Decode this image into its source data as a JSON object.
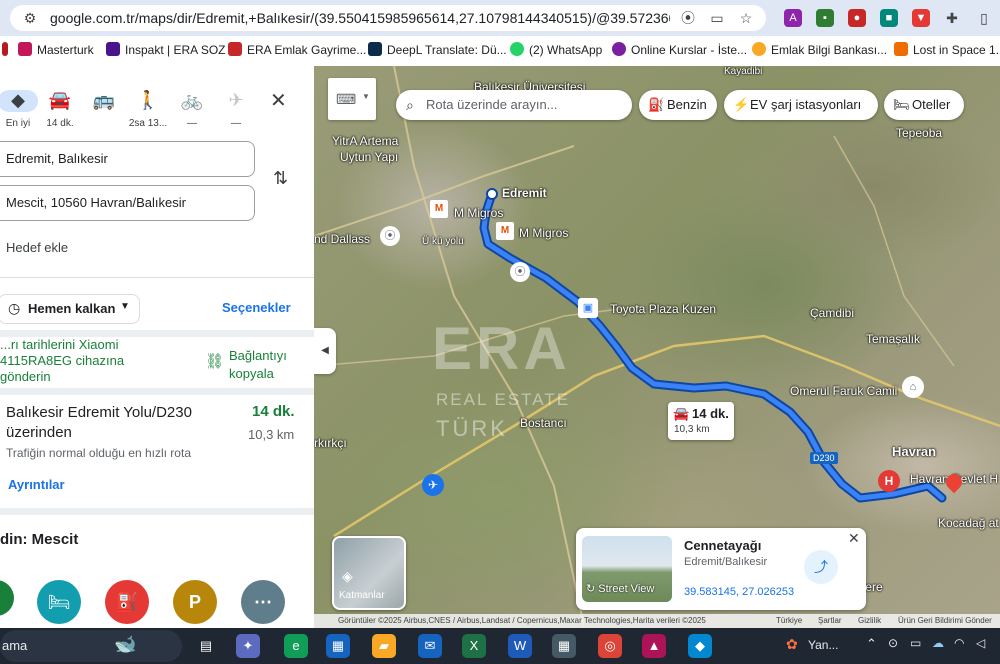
{
  "browser": {
    "url": "google.com.tr/maps/dir/Edremit,+Balıkesir/(39.550415985965614,27.10798144340515)/@39.5723608,27.02...",
    "bookmarks": [
      "Masterturk",
      "Inspakt | ERA SOZ",
      "ERA Emlak Gayrime...",
      "DeepL Translate: Dü...",
      "(2) WhatsApp",
      "Online Kurslar - İste...",
      "Emlak Bilgi Bankası...",
      "Lost in Space 1. Se"
    ]
  },
  "travel_modes": [
    {
      "name": "best",
      "label": "En iyi",
      "icon": "directions-icon"
    },
    {
      "name": "car",
      "label": "14 dk.",
      "icon": "car-icon"
    },
    {
      "name": "transit",
      "label": "",
      "icon": "bus-icon"
    },
    {
      "name": "walk",
      "label": "2sa 13...",
      "icon": "walk-icon"
    },
    {
      "name": "bike",
      "label": "—",
      "icon": "bike-icon"
    },
    {
      "name": "flight",
      "label": "—",
      "icon": "plane-icon"
    }
  ],
  "directions": {
    "origin": "Edremit, Balıkesir",
    "destination": "Mescit, 10560 Havran/Balıkesir",
    "add_destination": "Hedef ekle",
    "depart_now": "Hemen kalkan",
    "options": "Seçenekler",
    "notice_line1": "...rı tarihlerini Xiaomi",
    "notice_line2": "4115RA8EG cihazına",
    "notice_line3": "gönderin",
    "link_label_1": "Bağlantıyı",
    "link_label_2": "kopyala",
    "route_title_1": "Balıkesir Edremit Yolu/D230",
    "route_title_2": "üzerinden",
    "route_time": "14 dk.",
    "route_distance": "10,3 km",
    "route_note": "Trafiğin normal olduğu en hızlı rota",
    "details": "Ayrıntılar",
    "nearby_title": "din: Mescit"
  },
  "map": {
    "search_placeholder": "Rota üzerinde arayın...",
    "chips": [
      "Benzin",
      "EV şarj istasyonları",
      "Oteller"
    ],
    "labels": {
      "edremit": "Edremit",
      "migros1": "M Migros",
      "migros2": "M Migros",
      "toyota": "Toyota Plaza Kuzen",
      "balikesir_uni": "Balıkesir Üniversitesi",
      "yitra": "YitrA Artema",
      "yapi": "Uytun Yapı",
      "dallas": "nd Dallass",
      "camdibi": "Çamdibi",
      "temasalik": "Temaşalık",
      "omerul": "Omerul Faruk Camii",
      "havran": "Havran",
      "havran_hosp": "Havran Devlet H",
      "kocadag": "Kocadağ at",
      "tepeoba": "Tepeoba",
      "bostanci": "Bostancı",
      "kirkci": "rkırkçı",
      "kayadibi": "Kayadibi",
      "uskudar": "Ü kü yolu",
      "tunca": "ekdere",
      "d230": "D230"
    },
    "route_badge_time": "14 dk.",
    "route_badge_distance": "10,3 km",
    "watermark_main": "ERA",
    "watermark_sub": "REAL ESTATE",
    "watermark_sub2": "TÜRK",
    "layers_label": "Katmanlar",
    "card_title": "Cennetayağı",
    "card_subtitle": "Edremit/Balıkesir",
    "card_coords": "39.583145, 27.026253",
    "card_streetview": "Street View",
    "attribution": "Görüntüler ©2025 Airbus,CNES / Airbus,Landsat / Copernicus,Maxar Technologies,Harita verileri ©2025",
    "footer_links": [
      "Türkiye",
      "Şartlar",
      "Gizlilik",
      "Ürün Geri Bildirimi Gönder"
    ]
  },
  "taskbar": {
    "search_text": "ama",
    "weather": "Yan..."
  }
}
